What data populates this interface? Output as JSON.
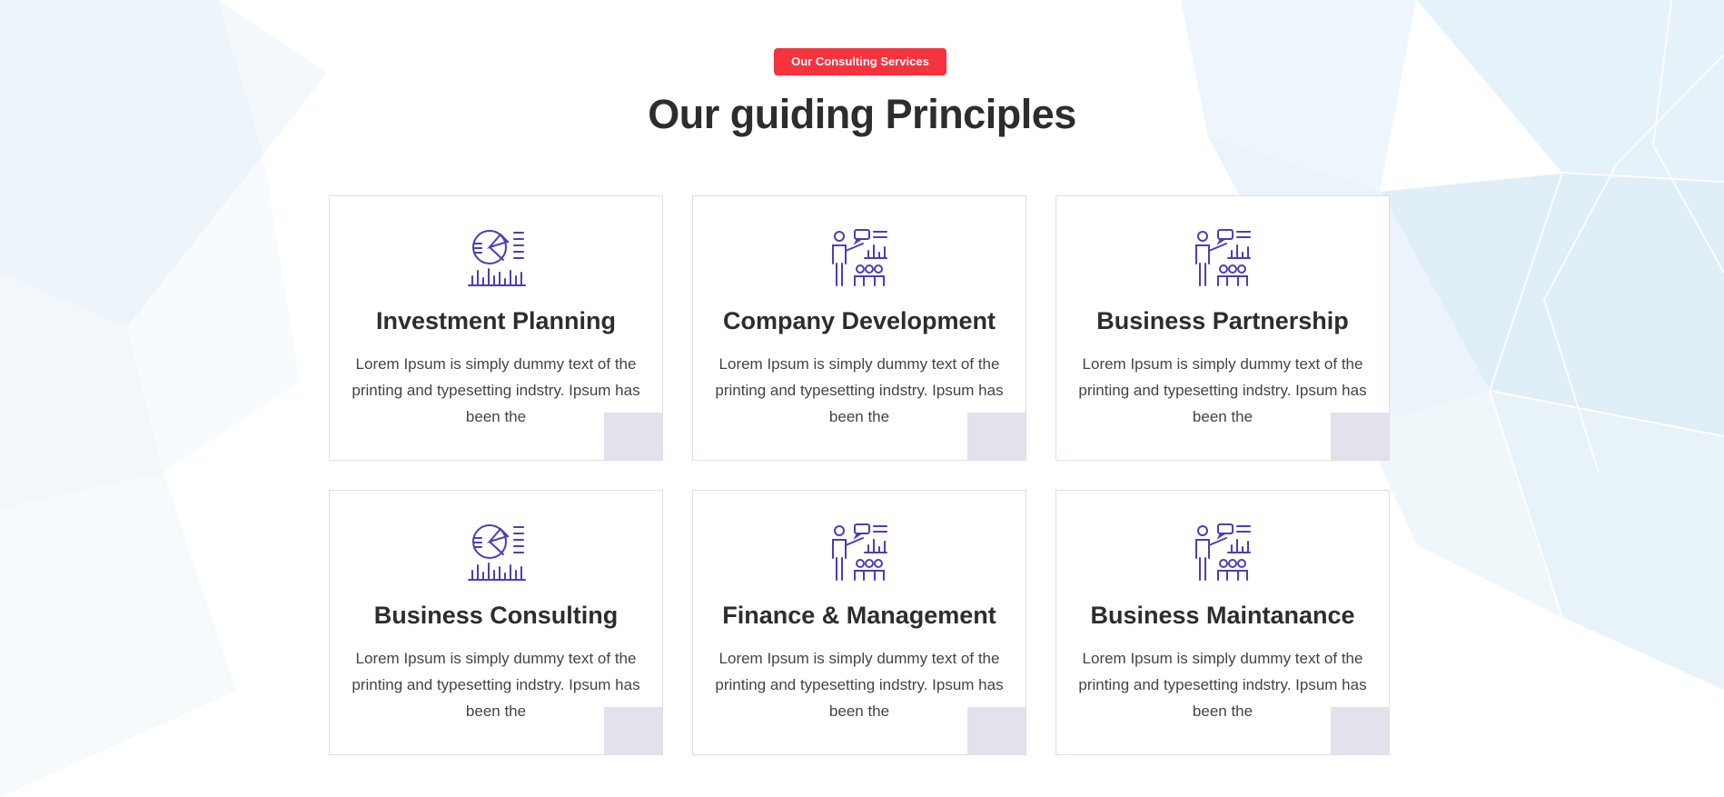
{
  "header": {
    "badge_label": "Our Consulting Services",
    "title": "Our guiding Principles"
  },
  "colors": {
    "accent": "#f5333f",
    "icon": "#4a3fb4",
    "corner": "#e2e1ec"
  },
  "cards": [
    {
      "title": "Investment Planning",
      "icon": "pie-chart-icon",
      "text": "Lorem Ipsum is simply dummy text of the printing and typesetting indstry. Ipsum has been the"
    },
    {
      "title": "Company Development",
      "icon": "presentation-icon",
      "text": "Lorem Ipsum is simply dummy text of the printing and typesetting indstry. Ipsum has been the"
    },
    {
      "title": "Business Partnership",
      "icon": "presentation-icon",
      "text": "Lorem Ipsum is simply dummy text of the printing and typesetting indstry. Ipsum has been the"
    },
    {
      "title": "Business Consulting",
      "icon": "pie-chart-icon",
      "text": "Lorem Ipsum is simply dummy text of the printing and typesetting indstry. Ipsum has been the"
    },
    {
      "title": "Finance & Management",
      "icon": "presentation-icon",
      "text": "Lorem Ipsum is simply dummy text of the printing and typesetting indstry. Ipsum has been the"
    },
    {
      "title": "Business Maintanance",
      "icon": "presentation-icon",
      "text": "Lorem Ipsum is simply dummy text of the printing and typesetting indstry. Ipsum has been the"
    }
  ]
}
